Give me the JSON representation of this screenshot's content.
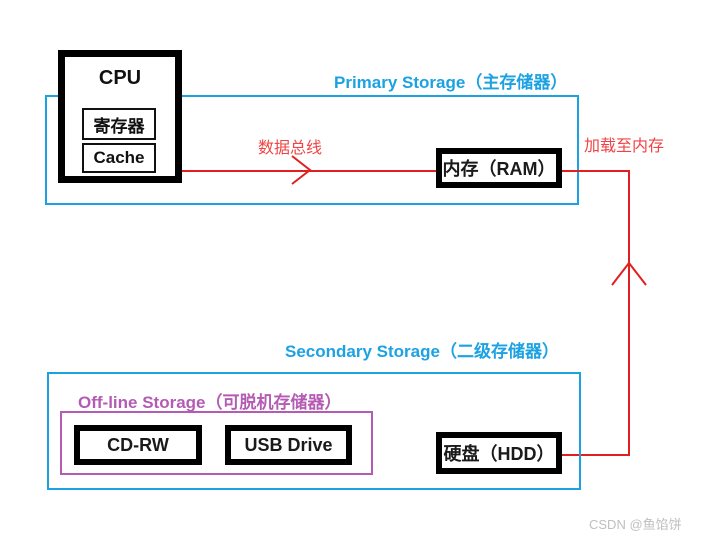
{
  "diagram": {
    "title": "Computer Storage Hierarchy Diagram",
    "colors": {
      "blue": "#1ca2e3",
      "purple": "#b45bb4",
      "red": "#e02020",
      "black": "#000000",
      "watermark_gray": "#bfbfbf"
    },
    "groups": [
      {
        "id": "primary-storage",
        "label": "Primary Storage（主存储器）",
        "color": "#1ca2e3"
      },
      {
        "id": "secondary-storage",
        "label": "Secondary Storage（二级存储器）",
        "color": "#1ca2e3"
      },
      {
        "id": "offline-storage",
        "label": "Off-line Storage（可脱机存储器）",
        "color": "#b45bb4"
      }
    ],
    "nodes": [
      {
        "id": "cpu",
        "label": "CPU"
      },
      {
        "id": "register",
        "label": "寄存器"
      },
      {
        "id": "cache",
        "label": "Cache"
      },
      {
        "id": "ram",
        "label": "内存（RAM）"
      },
      {
        "id": "cdrw",
        "label": "CD-RW"
      },
      {
        "id": "usb",
        "label": "USB Drive"
      },
      {
        "id": "hdd",
        "label": "硬盘（HDD）"
      }
    ],
    "connections": [
      {
        "id": "data-bus",
        "label": "数据总线",
        "from": "cpu",
        "to": "ram",
        "color": "#e02020",
        "direction": "right"
      },
      {
        "id": "load-to-ram",
        "label": "加载至内存",
        "from": "hdd",
        "to": "ram",
        "color": "#e02020",
        "direction": "up"
      }
    ]
  },
  "watermark": "CSDN @鱼馅饼"
}
